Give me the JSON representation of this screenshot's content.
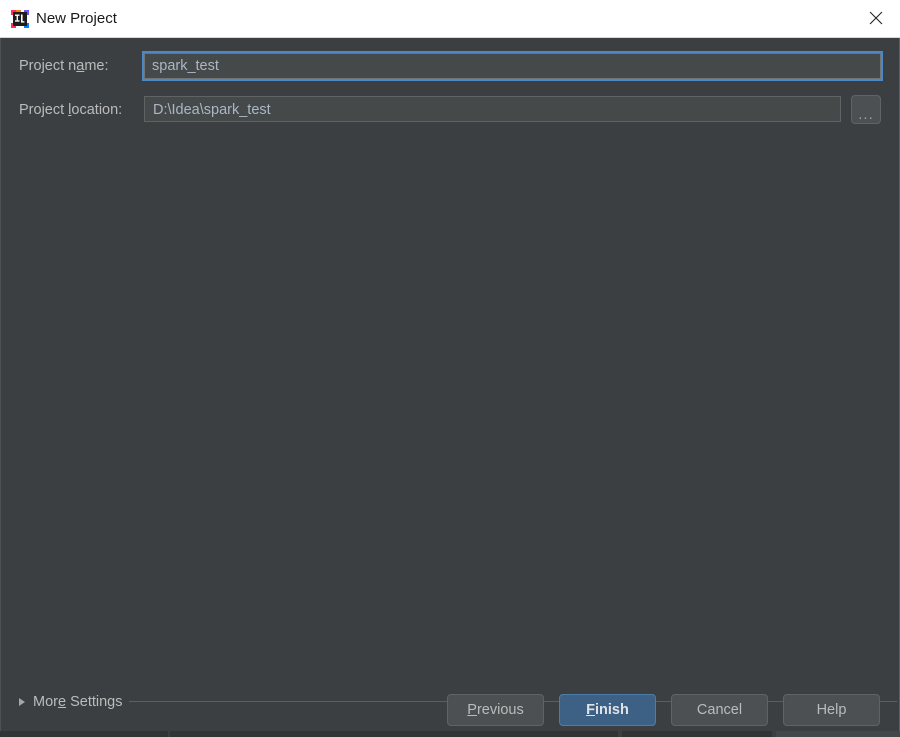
{
  "window": {
    "title": "New Project",
    "icon": "intellij-idea-icon",
    "close_label": "Close",
    "titlebar_bg": "#ffffff",
    "body_bg": "#3c3f41"
  },
  "form": {
    "project_name": {
      "label_before": "Project n",
      "label_mnemonic": "a",
      "label_after": "me:",
      "value": "spark_test",
      "placeholder": "",
      "focused": true
    },
    "project_location": {
      "label_before": "Project ",
      "label_mnemonic": "l",
      "label_after": "ocation:",
      "value": "D:\\Idea\\spark_test",
      "placeholder": "",
      "focused": false,
      "browse_label": "..."
    }
  },
  "more_settings": {
    "label_before": "Mor",
    "label_mnemonic": "e",
    "label_after": " Settings",
    "expanded": false,
    "arrow_icon": "chevron-right-icon"
  },
  "buttons": [
    {
      "name": "previous",
      "before": "",
      "mnemonic": "P",
      "after": "revious",
      "primary": false
    },
    {
      "name": "finish",
      "before": "",
      "mnemonic": "F",
      "after": "inish",
      "primary": true
    },
    {
      "name": "cancel",
      "before": "Cancel",
      "mnemonic": "",
      "after": "",
      "primary": false
    },
    {
      "name": "help",
      "before": "Help",
      "mnemonic": "",
      "after": "",
      "primary": false
    }
  ],
  "colors": {
    "accent_focus": "#4a88c7",
    "primary_button": "#3d6185",
    "field_bg": "#45494a",
    "text": "#bbbbbb",
    "field_text": "#a9b7c6"
  }
}
